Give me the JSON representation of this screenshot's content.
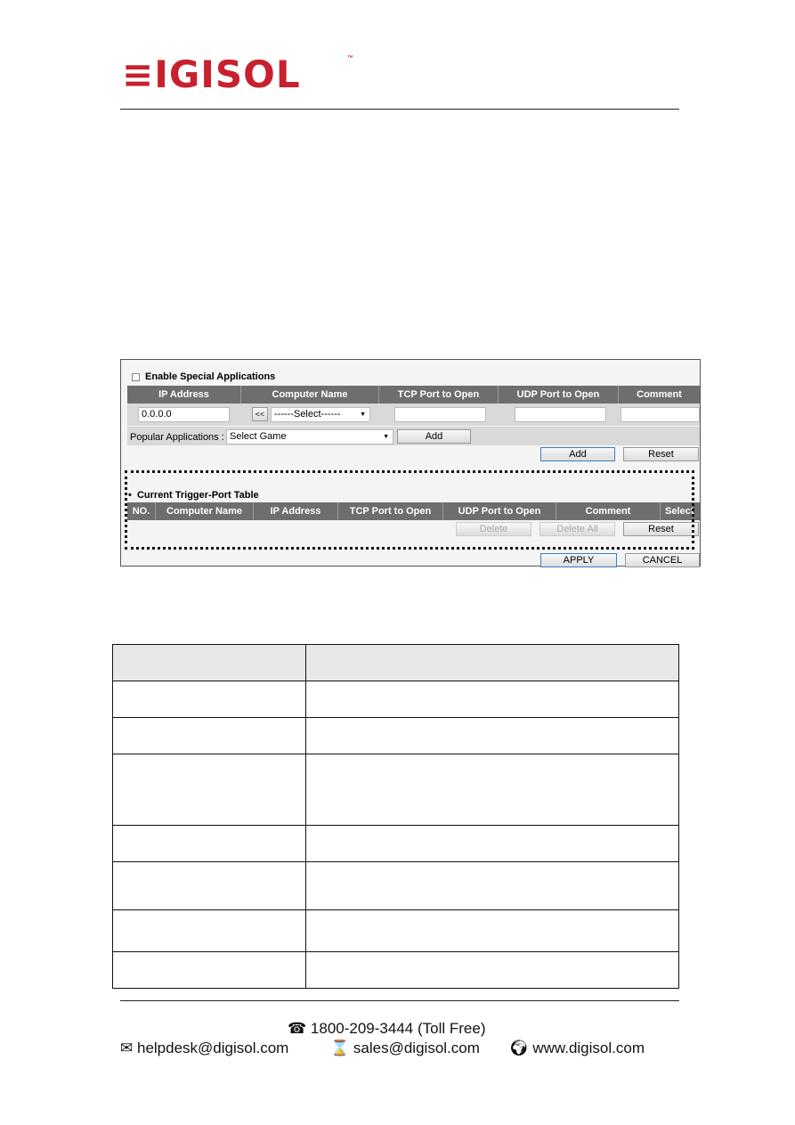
{
  "brand": {
    "logo_text": "DIGISOL",
    "tm": "™",
    "color": "#c8202f"
  },
  "ui": {
    "enable_label": "Enable Special Applications",
    "enable_checked": false,
    "columns": [
      "IP Address",
      "Computer Name",
      "TCP Port to Open",
      "UDP Port to Open",
      "Comment"
    ],
    "ip_value": "0.0.0.0",
    "copy_button": "<<",
    "computer_select": "------Select------",
    "popular_label": "Popular Applications :",
    "game_select": "Select Game",
    "popular_add": "Add",
    "add": "Add",
    "reset": "Reset",
    "table_title": "Current Trigger-Port Table",
    "table_columns": [
      "NO.",
      "Computer Name",
      "IP Address",
      "TCP Port to Open",
      "UDP Port to Open",
      "Comment",
      "Select"
    ],
    "delete": "Delete",
    "delete_all": "Delete All",
    "reset2": "Reset",
    "apply": "APPLY",
    "cancel": "CANCEL"
  },
  "footer": {
    "phone": "1800-209-3444 (Toll Free)",
    "helpdesk": "helpdesk@digisol.com",
    "sales": "sales@digisol.com",
    "web": "www.digisol.com"
  }
}
